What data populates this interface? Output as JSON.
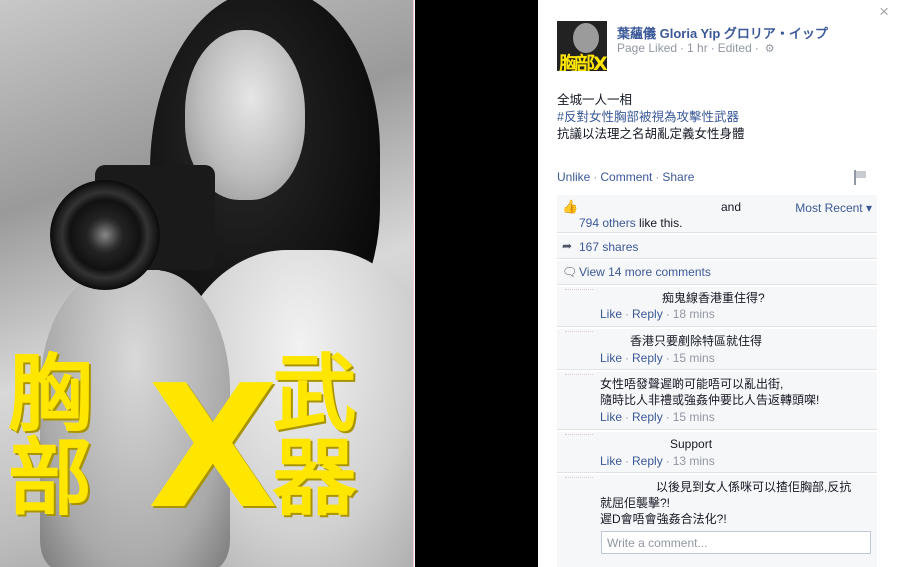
{
  "photo": {
    "overlay_left": "胸部",
    "overlay_x": "X",
    "overlay_right": "武器",
    "accent_color": "#ffe600"
  },
  "panel": {
    "close_icon": "×"
  },
  "post": {
    "avatar_text": "胸部X武器",
    "page_name": "葉蘊儀 Gloria Yip グロリア・イップ",
    "meta_status": "Page Liked",
    "meta_time": "1 hr",
    "meta_edited": "Edited",
    "text_line1": "全城一人一相",
    "text_line2_tag": "#反對女性胸部被視為攻擊性武器",
    "text_line3": "抗議以法理之名胡亂定義女性身體"
  },
  "actions": {
    "unlike": "Unlike",
    "comment": "Comment",
    "share": "Share"
  },
  "likes": {
    "and_text": "and",
    "most_recent": "Most Recent",
    "count_link": "794 others",
    "suffix": " like this."
  },
  "shares": {
    "label": "167 shares"
  },
  "more_comments": {
    "label": "View 14 more comments"
  },
  "comments": [
    {
      "text": "痴鬼線香港重住得?",
      "like": "Like",
      "reply": "Reply",
      "time": "18 mins"
    },
    {
      "text": "香港只要剷除特區就住得",
      "like": "Like",
      "reply": "Reply",
      "time": "15 mins"
    },
    {
      "text": "女性唔發聲遲啲可能唔可以亂出街,\n隨時比人非禮或強姦仲要比人告返轉頭㗎!",
      "like": "Like",
      "reply": "Reply",
      "time": "15 mins"
    },
    {
      "text": "Support",
      "like": "Like",
      "reply": "Reply",
      "time": "13 mins"
    },
    {
      "text": "以後見到女人係咪可以揸佢胸部,反抗\n就屈佢襲擊?!\n遲D會唔會強姦合法化?!"
    }
  ],
  "composer": {
    "placeholder": "Write a comment..."
  },
  "icons": {
    "like": "thumbs-up-icon",
    "share": "share-arrow-icon",
    "comment": "speech-bubble-icon",
    "gear": "gear-icon",
    "flag": "flag-icon",
    "close": "close-icon",
    "dropdown": "caret-down-icon"
  },
  "colors": {
    "link": "#3b5998",
    "meta": "#9197a3",
    "box_bg": "#f6f7f8",
    "overlay_yellow": "#ffe600"
  }
}
